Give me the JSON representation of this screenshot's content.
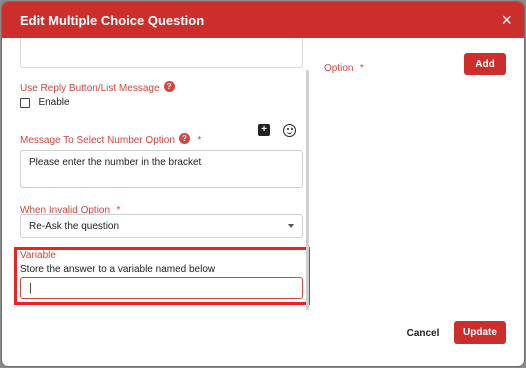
{
  "dialog": {
    "title": "Edit Multiple Choice Question",
    "close_icon": "×"
  },
  "reply_button": {
    "label": "Use Reply Button/List Message",
    "help": "?",
    "checkbox_label": "Enable",
    "checked": false
  },
  "message_option": {
    "label": "Message To Select Number Option",
    "help": "?",
    "required": "*",
    "icons": [
      "add-note-icon",
      "emoji-icon"
    ],
    "note_glyph": "+",
    "value": "Please enter the number in the bracket"
  },
  "invalid_option": {
    "label": "When Invalid Option",
    "required": "*",
    "selected": "Re-Ask the question"
  },
  "variable": {
    "label": "Variable",
    "description": "Store the answer to a variable named below",
    "value": "|"
  },
  "option": {
    "label": "Option",
    "required": "*",
    "add_button": "Add"
  },
  "footer": {
    "cancel_label": "Cancel",
    "update_label": "Update"
  },
  "colors": {
    "accent": "#cc2f2b",
    "highlight": "#ee2222"
  }
}
